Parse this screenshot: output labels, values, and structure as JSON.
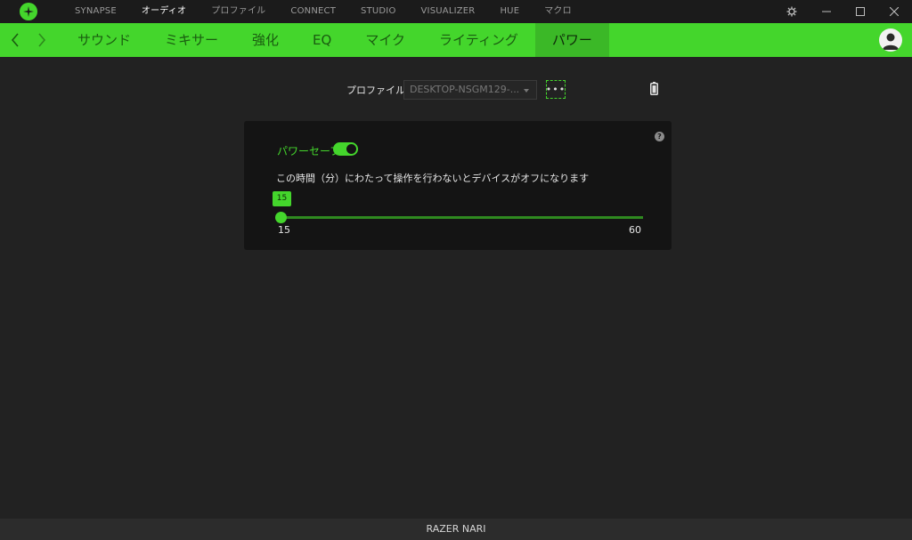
{
  "colors": {
    "accent": "#44d62c",
    "background": "#222222",
    "titlebar": "#1b1b1b",
    "card": "#141414"
  },
  "titlebar": {
    "logo_icon": "razer-snake-logo",
    "nav": [
      {
        "label": "SYNAPSE",
        "active": false
      },
      {
        "label": "オーディオ",
        "active": true
      },
      {
        "label": "プロファイル",
        "active": false
      },
      {
        "label": "CONNECT",
        "active": false
      },
      {
        "label": "STUDIO",
        "active": false
      },
      {
        "label": "VISUALIZER",
        "active": false
      },
      {
        "label": "HUE",
        "active": false
      },
      {
        "label": "マクロ",
        "active": false
      }
    ],
    "controls": [
      "settings-icon",
      "minimize-icon",
      "maximize-icon",
      "close-icon"
    ]
  },
  "subnav": {
    "tabs": [
      {
        "label": "サウンド",
        "active": false
      },
      {
        "label": "ミキサー",
        "active": false
      },
      {
        "label": "強化",
        "active": false
      },
      {
        "label": "EQ",
        "active": false
      },
      {
        "label": "マイク",
        "active": false
      },
      {
        "label": "ライティング",
        "active": false
      },
      {
        "label": "パワー",
        "active": true
      }
    ]
  },
  "profile": {
    "label": "プロファイル",
    "selected": "DESKTOP-NSGM129-...",
    "more_label": "•••"
  },
  "power_save": {
    "label": "パワーセーブ",
    "enabled": true,
    "description": "この時間（分）にわたって操作を行わないとデバイスがオフになります",
    "value": "15",
    "min": "15",
    "max": "60"
  },
  "footer": {
    "device_name": "RAZER NARI"
  }
}
